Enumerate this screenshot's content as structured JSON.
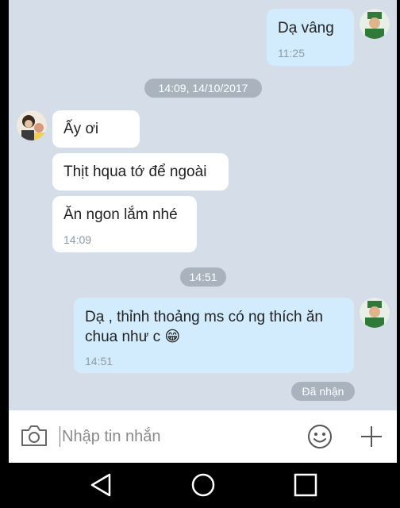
{
  "messages": [
    {
      "id": "m1",
      "direction": "out",
      "text": "Dạ vâng",
      "time": "11:25"
    },
    {
      "id": "m2",
      "direction": "in",
      "text": "Ấy ơi"
    },
    {
      "id": "m3",
      "direction": "in",
      "text": "Thịt hqua tớ để ngoài"
    },
    {
      "id": "m4",
      "direction": "in",
      "text": "Ăn ngon lắm nhé",
      "time": "14:09"
    },
    {
      "id": "m5",
      "direction": "out",
      "text_line1": "Dạ , thỉnh thoảng ms có ng thích ăn",
      "text_line2": "chua như c",
      "emoji": "😁",
      "time": "14:51"
    }
  ],
  "separators": {
    "date1": "14:09, 14/10/2017",
    "time2": "14:51"
  },
  "status": {
    "seen": "Đã nhận"
  },
  "composer": {
    "placeholder": "Nhập tin nhắn"
  },
  "icons": {
    "camera": "camera-icon",
    "emoji": "smiley-icon",
    "plus": "plus-icon",
    "back": "nav-back-icon",
    "home": "nav-home-icon",
    "recents": "nav-recents-icon"
  },
  "colors": {
    "chat_bg": "#d4dde8",
    "outgoing_bubble": "#d3ecfd",
    "incoming_bubble": "#ffffff",
    "pill": "#a9b3be"
  }
}
